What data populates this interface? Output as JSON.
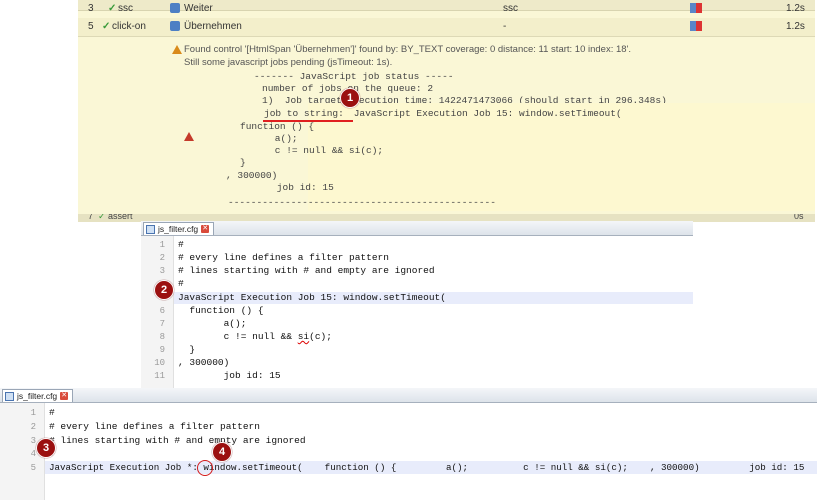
{
  "log": {
    "prev_row": {
      "index": "3",
      "label": "ssc",
      "widget": "Weiter",
      "mid": "ssc",
      "time": "1.2s"
    },
    "main_row": {
      "index": "5",
      "label": "click-on",
      "widget": "Übernehmen",
      "mid": "-",
      "time": "1.2s"
    },
    "next_row": {
      "index": "7",
      "label": "assert",
      "time": "0s"
    },
    "message_line1": "Found control '[HtmlSpan 'Übernehmen']' found by: BY_TEXT coverage: 0 distance: 11 start: 10 index: 18'.",
    "message_line2": "Still some javascript jobs pending (jsTimeout: 1s).",
    "code_lines": [
      "------- JavaScript job status -----",
      "number of jobs on the queue: 2",
      "1)  Job target execution time: 1422471473066 (should start in 296.348s)",
      "job to string:",
      " JavaScript Execution Job 15: window.setTimeout(",
      "function () {",
      "    a();",
      "    c != null && si(c);",
      "}",
      ", 300000)",
      "    job id: 15",
      "-----------------------------------------------"
    ]
  },
  "editor1": {
    "tab_label": "js_filter.cfg",
    "line_numbers": [
      "1",
      "2",
      "3",
      "4",
      "5",
      "6",
      "7",
      "8",
      "9",
      "10",
      "11"
    ],
    "lines": [
      "#",
      "# every line defines a filter pattern",
      "# lines starting with # and empty are ignored",
      "#",
      "JavaScript Execution Job 15: window.setTimeout(",
      "  function () {",
      "        a();",
      "        c != null && ",
      "  }",
      ", 300000)",
      "        job id: 15"
    ],
    "line8_squiggle": "si",
    "line8_tail": "(c);"
  },
  "editor2": {
    "tab_label": "js_filter.cfg",
    "line_numbers": [
      "1",
      "2",
      "3",
      "4",
      "5"
    ],
    "lines": [
      "#",
      "# every line defines a filter pattern",
      "# lines starting with # and empty are ignored",
      "#"
    ],
    "line5_before": "JavaScript Execution Job ",
    "line5_marker": "*",
    "line5_after": ": window.setTimeout(    function () {         a();          c != null && si(c);    , 300000)         job id: 15"
  },
  "badges": [
    "1",
    "2",
    "3",
    "4"
  ],
  "colors": {
    "badge": "#9b1010",
    "log_bg": "#faf7d6",
    "highlight": "#e8ecfb",
    "mark_red": "#d31a1a"
  }
}
